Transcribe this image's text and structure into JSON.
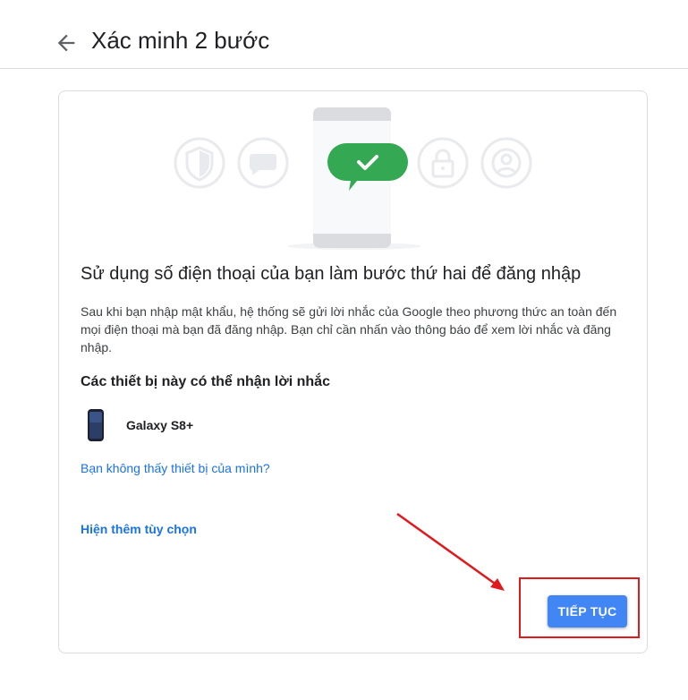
{
  "header": {
    "back_icon": "arrow-back-icon",
    "title": "Xác minh 2 bước"
  },
  "illustration": {
    "icons": [
      "shield-icon",
      "chat-bubble-icon",
      "phone-check-icon",
      "lock-icon",
      "account-circle-icon"
    ],
    "accent_green": "#34a853"
  },
  "content": {
    "headline": "Sử dụng số điện thoại của bạn làm bước thứ hai để đăng nhập",
    "description": "Sau khi bạn nhập mật khẩu, hệ thống sẽ gửi lời nhắc của Google theo phương thức an toàn đến mọi điện thoại mà bạn đã đăng nhập. Bạn chỉ cần nhấn vào thông báo để xem lời nhắc và đăng nhập.",
    "devices_title": "Các thiết bị này có thể nhận lời nhắc",
    "devices": [
      {
        "name": "Galaxy S8+",
        "icon": "smartphone-icon"
      }
    ],
    "missing_device_link": "Bạn không thấy thiết bị của mình?",
    "more_options_link": "Hiện thêm tùy chọn",
    "continue_label": "TIẾP TỤC"
  },
  "colors": {
    "primary_button": "#4285f4",
    "link": "#1a73e8",
    "annotation_red": "#e0191e"
  }
}
